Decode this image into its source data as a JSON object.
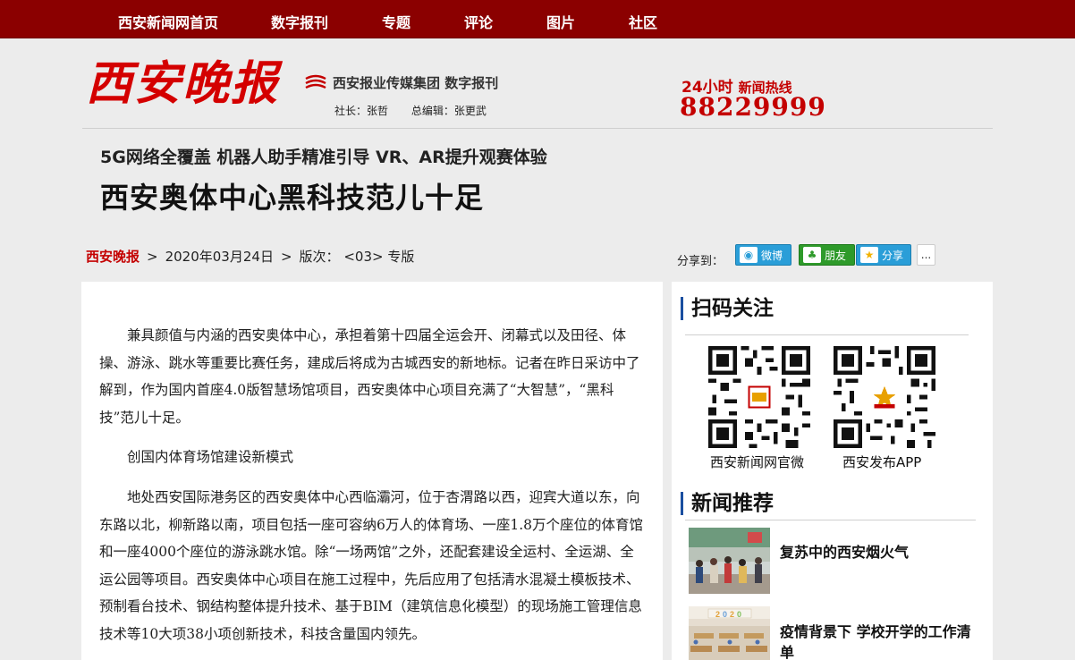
{
  "nav": {
    "items": [
      {
        "label": "西安新闻网首页"
      },
      {
        "label": "数字报刊"
      },
      {
        "label": "专题"
      },
      {
        "label": "评论"
      },
      {
        "label": "图片"
      },
      {
        "label": "社区"
      }
    ]
  },
  "masthead": {
    "logo_text": "西安晚报",
    "group_name": "西安报业传媒集团 数字报刊",
    "publisher": "社长：张哲",
    "chief_editor": "总编辑：张更武",
    "hotline_hours": "24小时",
    "hotline_label": "新闻热线",
    "hotline_number": "88229999"
  },
  "article": {
    "subtitle": "5G网络全覆盖 机器人助手精准引导 VR、AR提升观赛体验",
    "headline": "西安奥体中心黑科技范儿十足",
    "paper": "西安晚报",
    "date": "2020年03月24日",
    "edition_label": "版次：",
    "edition": "<03> 专版",
    "paragraphs": [
      "兼具颜值与内涵的西安奥体中心，承担着第十四届全运会开、闭幕式以及田径、体操、游泳、跳水等重要比赛任务，建成后将成为古城西安的新地标。记者在昨日采访中了解到，作为国内首座4.0版智慧场馆项目，西安奥体中心项目充满了“大智慧”，“黑科技”范儿十足。",
      "创国内体育场馆建设新模式",
      "地处西安国际港务区的西安奥体中心西临灞河，位于杏渭路以西，迎宾大道以东，向东路以北，柳新路以南，项目包括一座可容纳6万人的体育场、一座1.8万个座位的体育馆和一座4000个座位的游泳跳水馆。除“一场两馆”之外，还配套建设全运村、全运湖、全运公园等项目。西安奥体中心项目在施工过程中，先后应用了包括清水混凝土模板技术、预制看台技术、钢结构整体提升技术、基于BIM（建筑信息化模型）的现场施工管理信息技术等10大项38小项创新技术，科技含量国内领先。"
    ]
  },
  "share": {
    "label": "分享到：",
    "weibo": "微博",
    "pengyou": "朋友",
    "qzone": "分享",
    "more": "..."
  },
  "sidebar": {
    "qr_title": "扫码关注",
    "qr_items": [
      {
        "label": "西安新闻网官微"
      },
      {
        "label": "西安发布APP"
      }
    ],
    "news_title": "新闻推荐",
    "news_items": [
      {
        "title": "复苏中的西安烟火气"
      },
      {
        "title": "疫情背景下 学校开学的工作清单"
      }
    ]
  },
  "colors": {
    "nav_bg": "#8b0000",
    "brand_red": "#c40000",
    "accent_blue": "#1a4fa0"
  }
}
